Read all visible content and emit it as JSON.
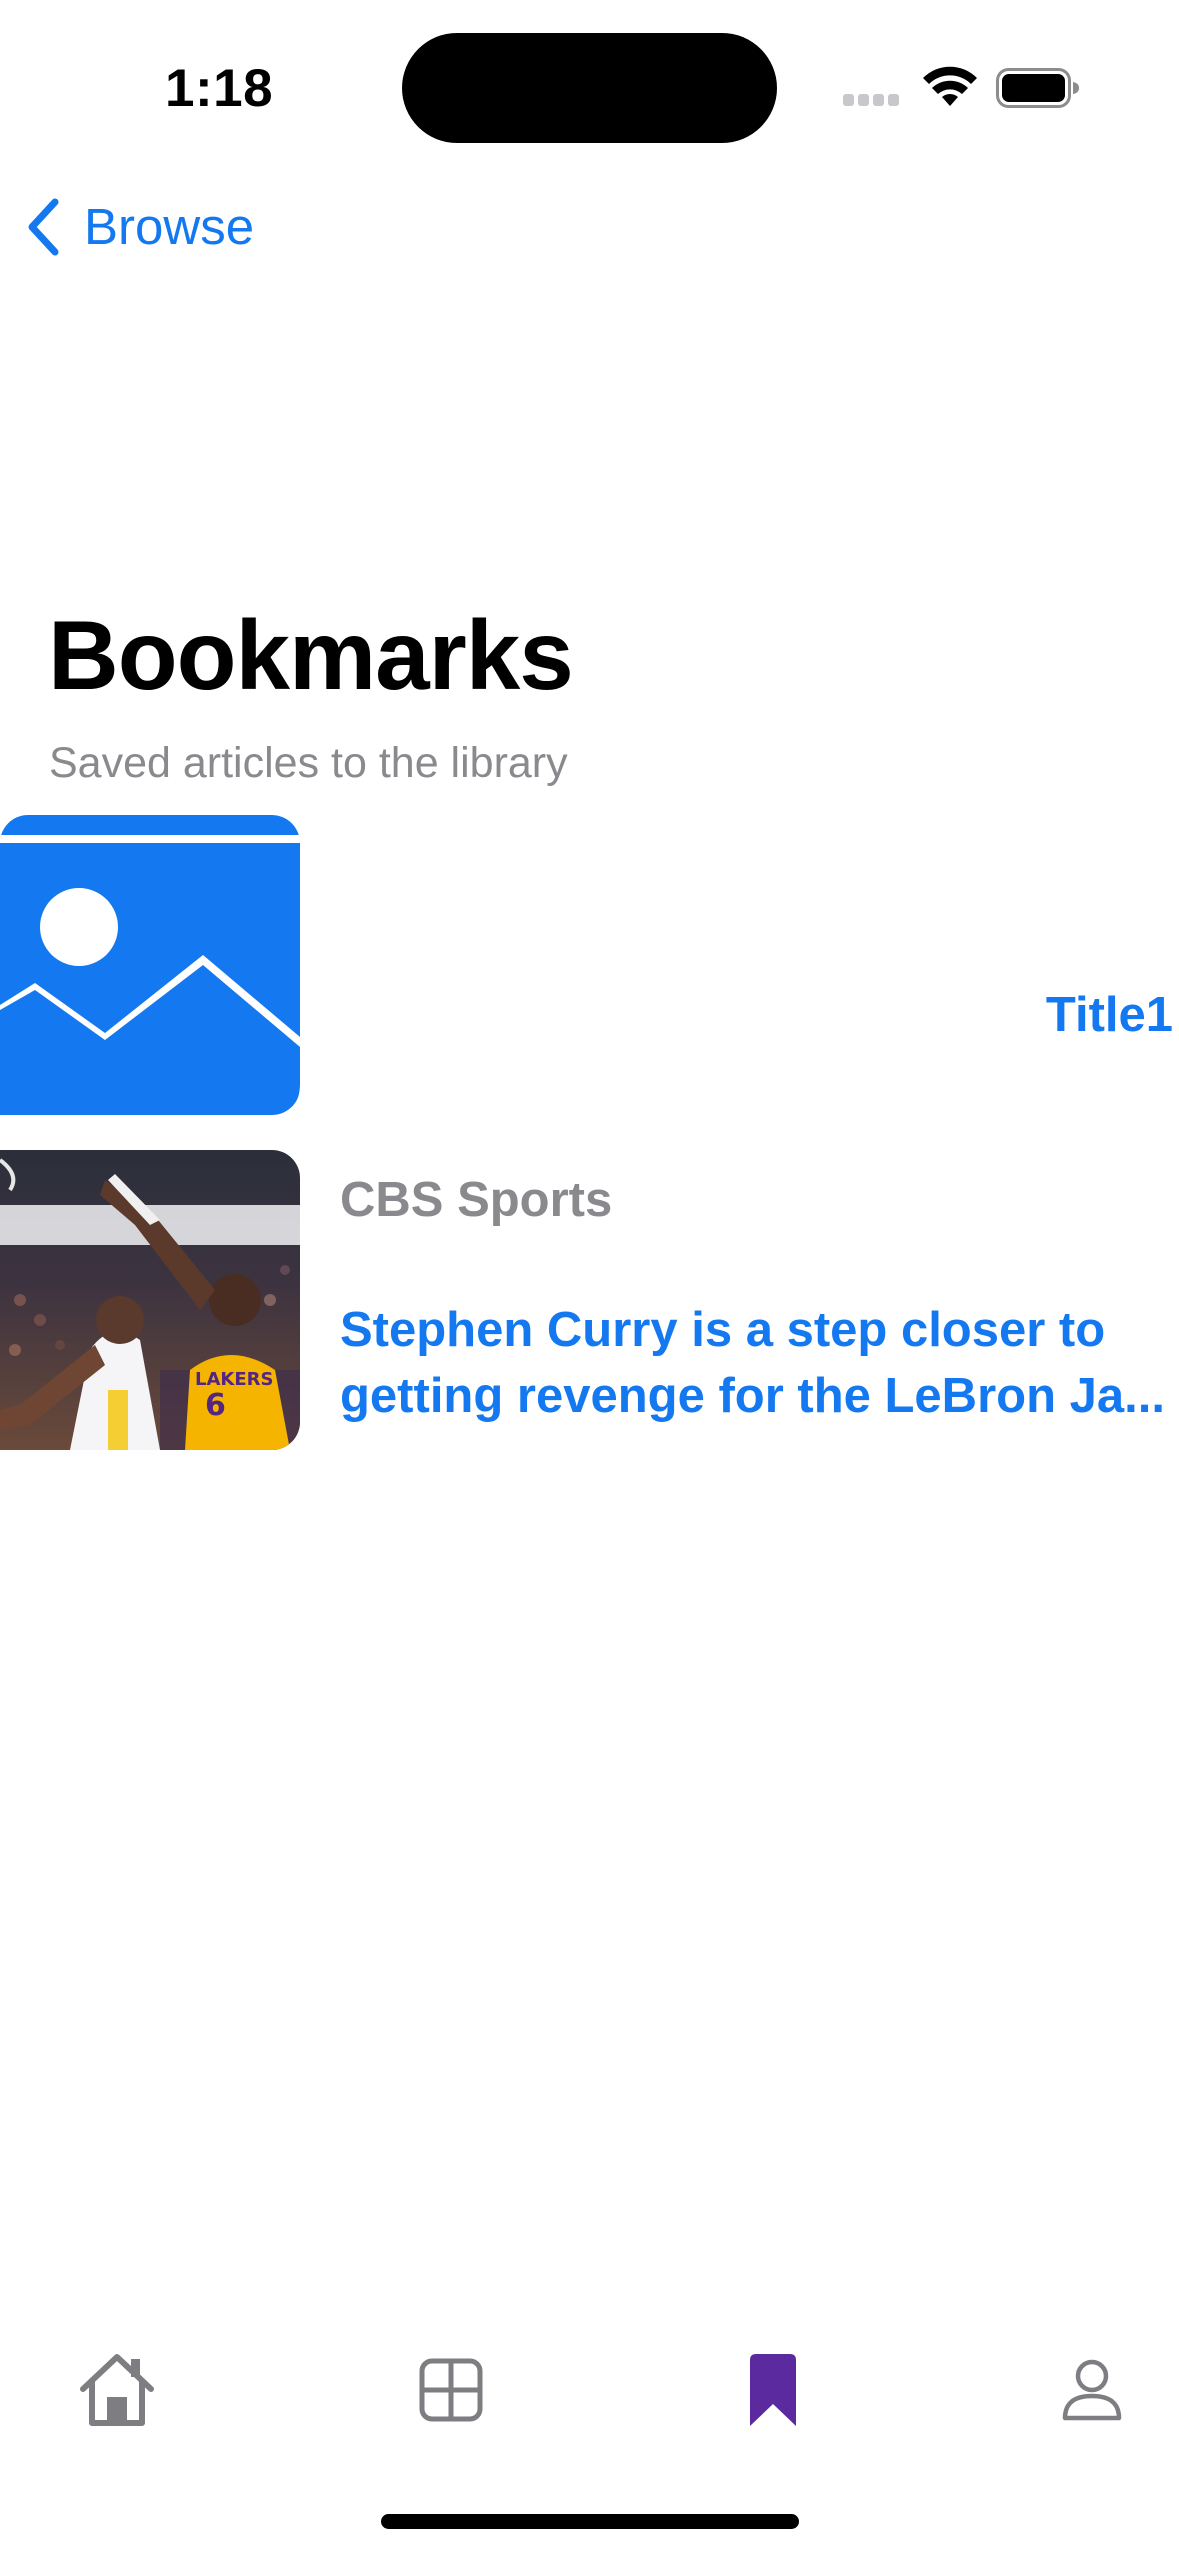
{
  "status_bar": {
    "time": "1:18"
  },
  "nav": {
    "back_label": "Browse"
  },
  "header": {
    "title": "Bookmarks",
    "subtitle": "Saved articles to the library"
  },
  "articles": [
    {
      "thumbnail": "image-placeholder-icon",
      "title": "Title1"
    },
    {
      "thumbnail": "basketball-photo",
      "source": "CBS Sports",
      "headline_line1": "Stephen Curry is a step closer to",
      "headline_line2": "getting revenge for the LeBron Ja..."
    }
  ],
  "tab_bar": {
    "tabs": [
      {
        "icon": "home-icon",
        "selected": false
      },
      {
        "icon": "grid-icon",
        "selected": false
      },
      {
        "icon": "bookmark-icon",
        "selected": true
      },
      {
        "icon": "person-icon",
        "selected": false
      }
    ],
    "active_color": "#5B2A9E",
    "inactive_color": "#7d7d82"
  },
  "colors": {
    "accent": "#1479F0",
    "secondary_text": "#8a8a8e"
  }
}
